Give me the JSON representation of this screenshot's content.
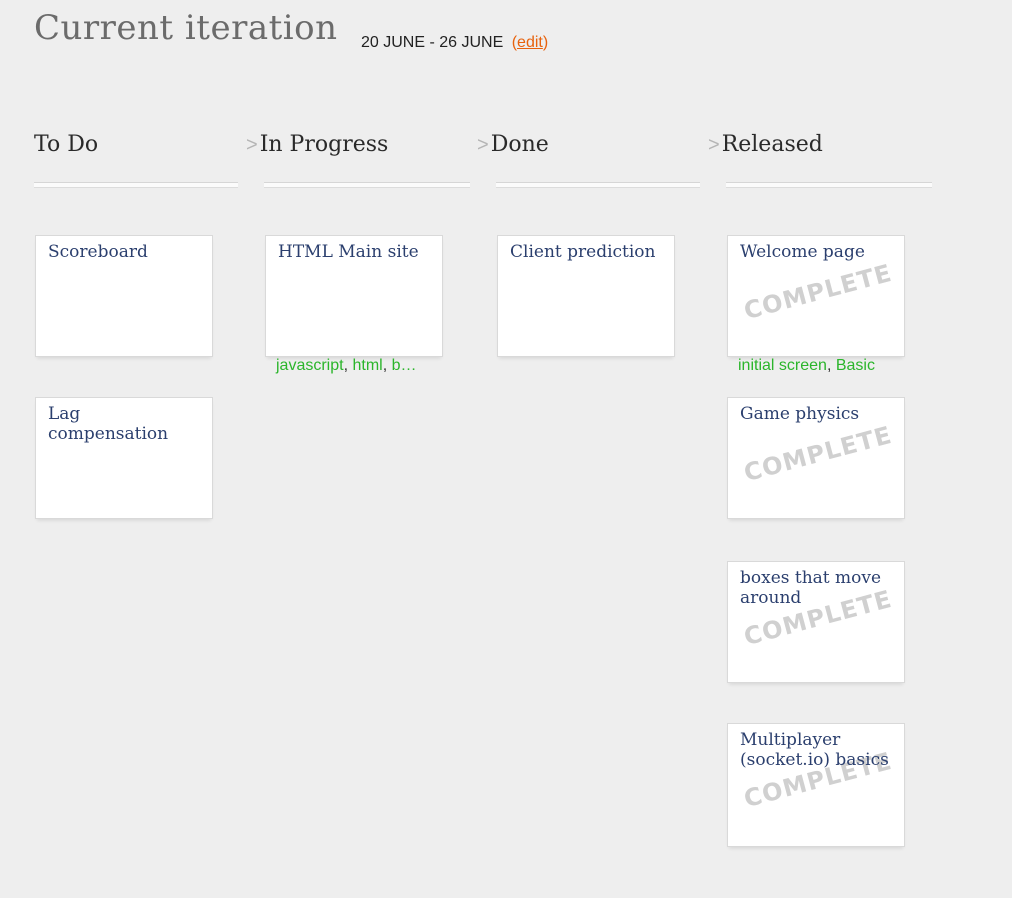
{
  "header": {
    "title": "Current iteration",
    "date_range": "20 JUNE - 26 JUNE",
    "edit_open": "(",
    "edit_label": "edit",
    "edit_close": ")"
  },
  "columns": [
    {
      "label": "To Do",
      "arrow": ""
    },
    {
      "label": "In Progress",
      "arrow": ">"
    },
    {
      "label": "Done",
      "arrow": ">"
    },
    {
      "label": "Released",
      "arrow": ">"
    }
  ],
  "stamp_text": "COMPLETE",
  "cards": {
    "todo": [
      {
        "title": "Scoreboard"
      },
      {
        "title": "Lag compensation"
      }
    ],
    "in_progress": [
      {
        "title": "HTML Main site",
        "tags": [
          "javascript",
          "html",
          "b…"
        ]
      }
    ],
    "done": [
      {
        "title": "Client prediction"
      }
    ],
    "released": [
      {
        "title": "Welcome page",
        "complete": true,
        "tags": [
          "initial screen",
          "Basic"
        ]
      },
      {
        "title": "Game physics",
        "complete": true
      },
      {
        "title": "boxes that move around",
        "complete": true
      },
      {
        "title": "Multiplayer (socket.io) basics",
        "complete": true
      }
    ]
  },
  "colors": {
    "background": "#eeeeee",
    "card_title": "#2b3f6e",
    "tag": "#2bb52b",
    "edit_link": "#e8620d",
    "stamp": "#d0d0d0"
  }
}
